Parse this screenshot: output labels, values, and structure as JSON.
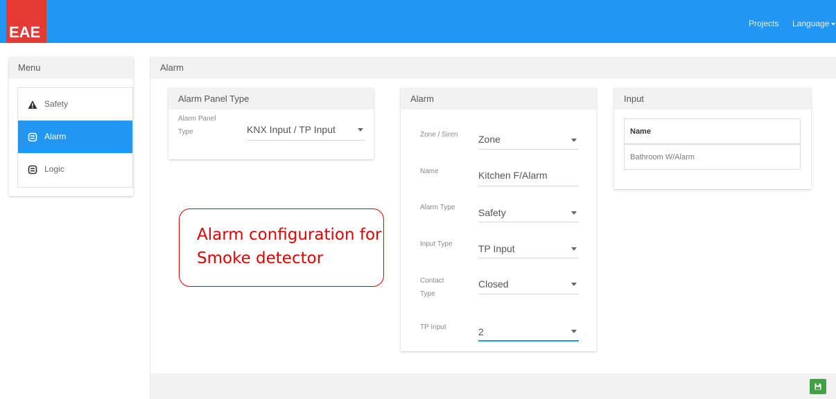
{
  "navbar": {
    "logo_text": "EAE",
    "links": {
      "projects": "Projects",
      "language": "Language"
    },
    "colors": {
      "bar": "#2196f3",
      "logo": "#e53935"
    }
  },
  "menu": {
    "title": "Menu",
    "items": [
      {
        "label": "Safety",
        "icon": "warning-triangle-icon",
        "active": false
      },
      {
        "label": "Alarm",
        "icon": "alarm-panel-icon",
        "active": true
      },
      {
        "label": "Logic",
        "icon": "logic-panel-icon",
        "active": false
      }
    ]
  },
  "main": {
    "title": "Alarm",
    "save_icon": "save-icon"
  },
  "alarm_panel_type": {
    "title": "Alarm Panel Type",
    "field_label": "Alarm Panel Type",
    "value": "KNX Input / TP Input"
  },
  "alarm": {
    "title": "Alarm",
    "fields": {
      "zone_siren": {
        "label": "Zone / Siren",
        "value": "Zone"
      },
      "name": {
        "label": "Name",
        "value": "Kitchen F/Alarm"
      },
      "alarm_type": {
        "label": "Alarm Type",
        "value": "Safety"
      },
      "input_type": {
        "label": "Input Type",
        "value": "TP Input"
      },
      "contact_type": {
        "label": "Contact Type",
        "value": "Closed"
      },
      "tp_input": {
        "label": "TP Input",
        "value": "2"
      }
    }
  },
  "input": {
    "title": "Input",
    "columns": [
      "Name"
    ],
    "rows": [
      "Bathroom W/Alarm"
    ]
  },
  "callout": {
    "text": "Alarm configuration for Smoke detector",
    "color": "#e00000"
  }
}
